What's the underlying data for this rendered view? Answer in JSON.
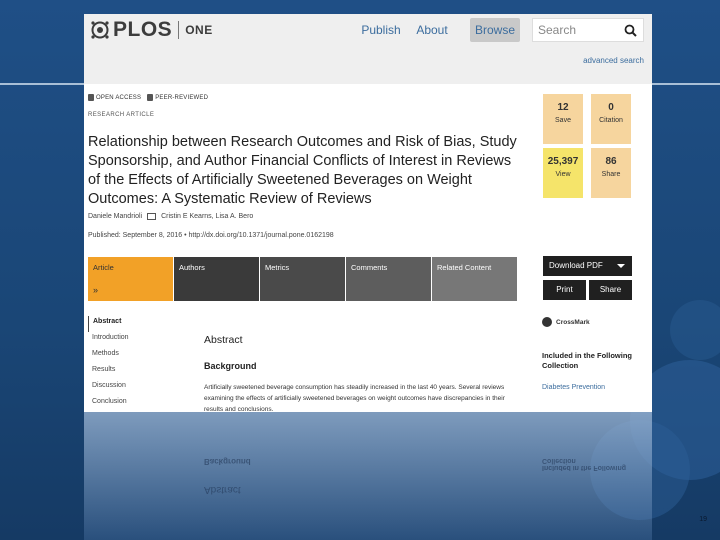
{
  "header": {
    "brand": "PLOS",
    "journal": "ONE",
    "nav": {
      "publish": "Publish",
      "about": "About",
      "browse": "Browse"
    },
    "search_placeholder": "Search",
    "advanced_search": "advanced search"
  },
  "article": {
    "flags": [
      "OPEN ACCESS",
      "PEER-REVIEWED"
    ],
    "kind": "RESEARCH ARTICLE",
    "title": "Relationship between Research Outcomes and Risk of Bias, Study Sponsorship, and Author Financial Conflicts of Interest in Reviews of the Effects of Artificially Sweetened Beverages on Weight Outcomes: A Systematic Review of Reviews",
    "authors": {
      "first": "Daniele Mandrioli",
      "rest": "Cristin E Kearns,  Lisa A. Bero"
    },
    "published": "Published: September 8, 2016  •  http://dx.doi.org/10.1371/journal.pone.0162198"
  },
  "metrics": [
    {
      "value": "12",
      "label": "Save",
      "color": "#f6d59e"
    },
    {
      "value": "0",
      "label": "Citation",
      "color": "#f6d59e"
    },
    {
      "value": "25,397",
      "label": "View",
      "color": "#f5e46a"
    },
    {
      "value": "86",
      "label": "Share",
      "color": "#f6d59e"
    }
  ],
  "tabs": [
    {
      "label": "Article",
      "color": "#f2a127",
      "active": true
    },
    {
      "label": "Authors",
      "color": "#3a3a3a"
    },
    {
      "label": "Metrics",
      "color": "#4a4a4a"
    },
    {
      "label": "Comments",
      "color": "#5d5d5d"
    },
    {
      "label": "Related Content",
      "color": "#777777"
    }
  ],
  "actions": {
    "download": "Download PDF",
    "print": "Print",
    "share": "Share"
  },
  "toc": [
    "Abstract",
    "Introduction",
    "Methods",
    "Results",
    "Discussion",
    "Conclusion"
  ],
  "abstract": {
    "heading": "Abstract",
    "subheading": "Background",
    "text": "Artificially sweetened beverage consumption has steadily increased in the last 40 years. Several reviews examining the effects of artificially sweetened beverages on weight outcomes have discrepancies in their results and conclusions."
  },
  "sidebar": {
    "crossmark": "CrossMark",
    "included": "Included in the Following Collection",
    "collection": "Diabetes Prevention"
  },
  "slide": {
    "page_number": "19"
  }
}
